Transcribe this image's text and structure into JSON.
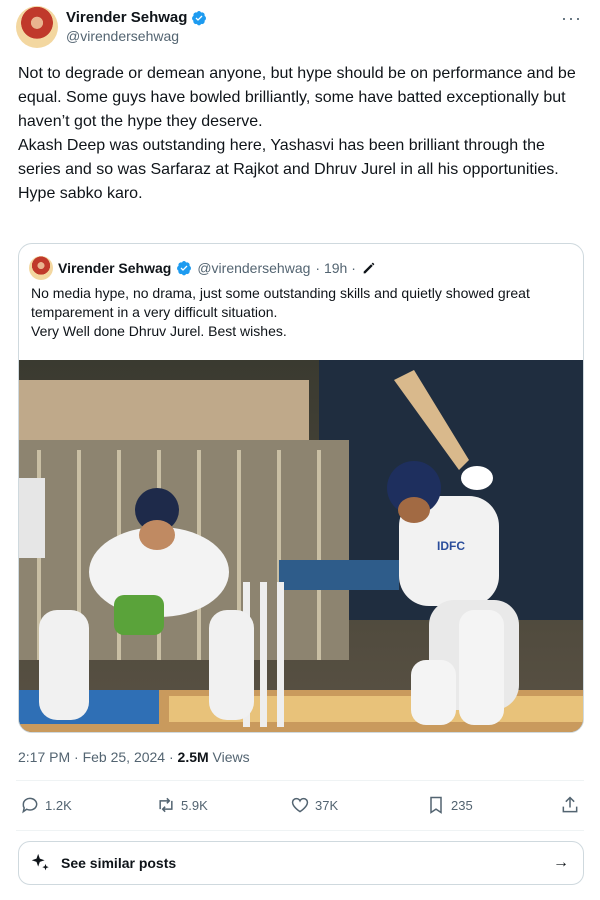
{
  "author": {
    "name": "Virender Sehwag",
    "handle": "@virendersehwag"
  },
  "post": {
    "text": "Not to degrade or demean anyone, but hype should be on performance and be equal. Some guys have bowled brilliantly, some have batted exceptionally but haven’t got the hype they deserve.\nAkash Deep was outstanding here, Yashasvi has been brilliant through the series and so was Sarfaraz at Rajkot and Dhruv Jurel in all his opportunities.\nHype sabko karo."
  },
  "quote": {
    "name": "Virender Sehwag",
    "handle": "@virendersehwag",
    "time": "· 19h ·",
    "text": "No media hype, no drama, just some outstanding skills and quietly showed great temparement in a very difficult situation.\nVery Well done Dhruv Jurel. Best wishes.",
    "image_jersey_text": "IDFC"
  },
  "meta": {
    "timestamp": "2:17 PM · Feb 25, 2024 ·",
    "views_count": "2.5M",
    "views_label": "Views"
  },
  "actions": {
    "replies": "1.2K",
    "reposts": "5.9K",
    "likes": "37K",
    "bookmarks": "235"
  },
  "similar": {
    "label": "See similar posts",
    "arrow": "→"
  },
  "more_glyph": "···",
  "colors": {
    "verified": "#1d9bf0",
    "muted": "#536471",
    "border": "#cfd9de"
  },
  "icons": [
    "verified-icon",
    "more-icon",
    "reply-icon",
    "repost-icon",
    "like-icon",
    "bookmark-icon",
    "share-icon",
    "sparkle-icon",
    "arrow-right-icon",
    "edit-icon"
  ]
}
